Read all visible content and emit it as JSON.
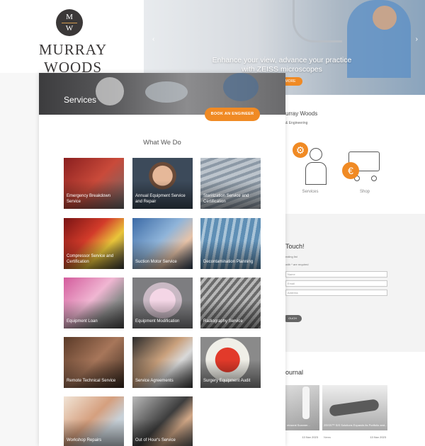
{
  "logo": {
    "monogram_top": "M",
    "monogram_bottom": "W",
    "name": "MURRAY WOODS"
  },
  "hero": {
    "headline_line1": "Enhance your view, advance your practice",
    "headline_line2": "with ZEISS microscopes",
    "button_label": "MORE",
    "prev_icon": "chevron-left-icon",
    "next_icon": "chevron-right-icon"
  },
  "back_page": {
    "company": "urray Woods",
    "company_sub": "& Engineering",
    "features": [
      {
        "label": "Services",
        "icon": "engineer-gear-icon"
      },
      {
        "label": "Shop",
        "icon": "shopping-cart-euro-icon"
      }
    ],
    "contact": {
      "title": "Touch!",
      "note1": "ealing list",
      "note2": "with * are required",
      "fields": [
        "Name",
        "Email",
        "Address"
      ],
      "button_label": "OUCH"
    },
    "journal": {
      "title": "ournal",
      "cards": [
        {
          "caption": "ntraoral Scanner...",
          "tag": "",
          "date": "13 Nov 2023"
        },
        {
          "caption": "ZEISS™ SIS Solutions Expands its Portfolio and...",
          "tag": "News",
          "date": "13 Nov 2023"
        }
      ]
    }
  },
  "front": {
    "banner_title": "Services",
    "book_button": "BOOK AN ENGINEER",
    "section_title": "What We Do",
    "services": [
      {
        "label": "Emergency Breakdown Service"
      },
      {
        "label": "Annual Equipment Service and Repair"
      },
      {
        "label": "Sterilization Service and Certification"
      },
      {
        "label": "Compressor Service and Certification"
      },
      {
        "label": "Suction Motor Service"
      },
      {
        "label": "Decontamination Planning"
      },
      {
        "label": "Equipment Loan"
      },
      {
        "label": "Equipment Modification"
      },
      {
        "label": "Radiography Service"
      },
      {
        "label": "Remote Technical Service"
      },
      {
        "label": "Service Agreements"
      },
      {
        "label": "Surgery Equipment Audit"
      },
      {
        "label": "Workshop Repairs"
      },
      {
        "label": "Out of Hour's Service"
      }
    ]
  },
  "colors": {
    "accent": "#f08a24",
    "logo_dark": "#3b3838",
    "logo_gold": "#d19a4e"
  }
}
